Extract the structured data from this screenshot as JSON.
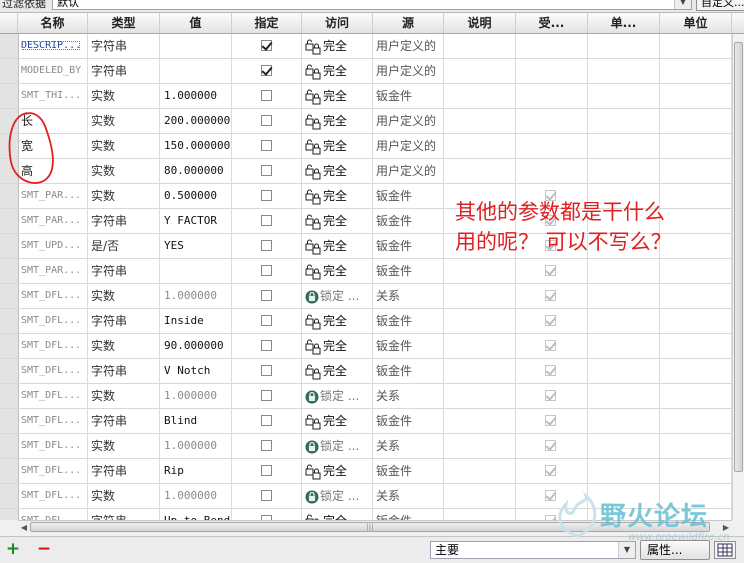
{
  "filter": {
    "label": "过滤依据",
    "value": "默认",
    "custom_button": "自定义..."
  },
  "columns": [
    "名称",
    "类型",
    "值",
    "指定",
    "访问",
    "源",
    "说明",
    "受...",
    "单...",
    "单位"
  ],
  "rows": [
    {
      "name": "DESCRIP...",
      "type": "字符串",
      "value": "",
      "designated": true,
      "access": "完全",
      "locked": false,
      "source": "用户定义的",
      "restricted": false,
      "name_style": "sel"
    },
    {
      "name": "MODELED_BY",
      "type": "字符串",
      "value": "",
      "designated": true,
      "access": "完全",
      "locked": false,
      "source": "用户定义的",
      "restricted": false,
      "name_style": "dim"
    },
    {
      "name": "SMT_THI...",
      "type": "实数",
      "value": "1.000000",
      "designated": false,
      "access": "完全",
      "locked": false,
      "source": "钣金件",
      "restricted": false,
      "name_style": "dim"
    },
    {
      "name": "长",
      "type": "实数",
      "value": "200.000000",
      "designated": false,
      "access": "完全",
      "locked": false,
      "source": "用户定义的",
      "restricted": false,
      "name_style": "cjk"
    },
    {
      "name": "宽",
      "type": "实数",
      "value": "150.000000",
      "designated": false,
      "access": "完全",
      "locked": false,
      "source": "用户定义的",
      "restricted": false,
      "name_style": "cjk"
    },
    {
      "name": "高",
      "type": "实数",
      "value": "80.000000",
      "designated": false,
      "access": "完全",
      "locked": false,
      "source": "用户定义的",
      "restricted": false,
      "name_style": "cjk"
    },
    {
      "name": "SMT_PAR...",
      "type": "实数",
      "value": "0.500000",
      "designated": false,
      "access": "完全",
      "locked": false,
      "source": "钣金件",
      "restricted": true,
      "name_style": "dim"
    },
    {
      "name": "SMT_PAR...",
      "type": "字符串",
      "value": "Y FACTOR",
      "designated": false,
      "access": "完全",
      "locked": false,
      "source": "钣金件",
      "restricted": true,
      "name_style": "dim"
    },
    {
      "name": "SMT_UPD...",
      "type": "是/否",
      "value": "YES",
      "designated": false,
      "access": "完全",
      "locked": false,
      "source": "钣金件",
      "restricted": true,
      "name_style": "dim"
    },
    {
      "name": "SMT_PAR...",
      "type": "字符串",
      "value": "",
      "designated": false,
      "access": "完全",
      "locked": false,
      "source": "钣金件",
      "restricted": true,
      "name_style": "dim"
    },
    {
      "name": "SMT_DFL...",
      "type": "实数",
      "value": "1.000000",
      "designated": false,
      "access": "锁定 ...",
      "locked": true,
      "source": "关系",
      "restricted": true,
      "name_style": "dim"
    },
    {
      "name": "SMT_DFL...",
      "type": "字符串",
      "value": "Inside",
      "designated": false,
      "access": "完全",
      "locked": false,
      "source": "钣金件",
      "restricted": true,
      "name_style": "dim"
    },
    {
      "name": "SMT_DFL...",
      "type": "实数",
      "value": "90.000000",
      "designated": false,
      "access": "完全",
      "locked": false,
      "source": "钣金件",
      "restricted": true,
      "name_style": "dim"
    },
    {
      "name": "SMT_DFL...",
      "type": "字符串",
      "value": "V Notch",
      "designated": false,
      "access": "完全",
      "locked": false,
      "source": "钣金件",
      "restricted": true,
      "name_style": "dim"
    },
    {
      "name": "SMT_DFL...",
      "type": "实数",
      "value": "1.000000",
      "designated": false,
      "access": "锁定 ...",
      "locked": true,
      "source": "关系",
      "restricted": true,
      "name_style": "dim"
    },
    {
      "name": "SMT_DFL...",
      "type": "字符串",
      "value": "Blind",
      "designated": false,
      "access": "完全",
      "locked": false,
      "source": "钣金件",
      "restricted": true,
      "name_style": "dim"
    },
    {
      "name": "SMT_DFL...",
      "type": "实数",
      "value": "1.000000",
      "designated": false,
      "access": "锁定 ...",
      "locked": true,
      "source": "关系",
      "restricted": true,
      "name_style": "dim"
    },
    {
      "name": "SMT_DFL...",
      "type": "字符串",
      "value": "Rip",
      "designated": false,
      "access": "完全",
      "locked": false,
      "source": "钣金件",
      "restricted": true,
      "name_style": "dim"
    },
    {
      "name": "SMT_DFL...",
      "type": "实数",
      "value": "1.000000",
      "designated": false,
      "access": "锁定 ...",
      "locked": true,
      "source": "关系",
      "restricted": true,
      "name_style": "dim"
    },
    {
      "name": "SMT_DFL...",
      "type": "字符串",
      "value": "Up to Bend",
      "designated": false,
      "access": "完全",
      "locked": false,
      "source": "钣金件",
      "restricted": true,
      "name_style": "dim"
    }
  ],
  "annotation": {
    "line1": "其他的参数都是干什么",
    "line2": "用的呢？ 可以不写么？"
  },
  "bottom": {
    "add_symbol": "+",
    "remove_symbol": "−",
    "combo_value": "主要",
    "properties_button": "属性..."
  },
  "watermark": {
    "text": "野火论坛",
    "url": "www.proewildfire.cn"
  },
  "colors": {
    "annotation": "#e02020",
    "add": "#1a8a1a",
    "remove": "#d01010"
  }
}
